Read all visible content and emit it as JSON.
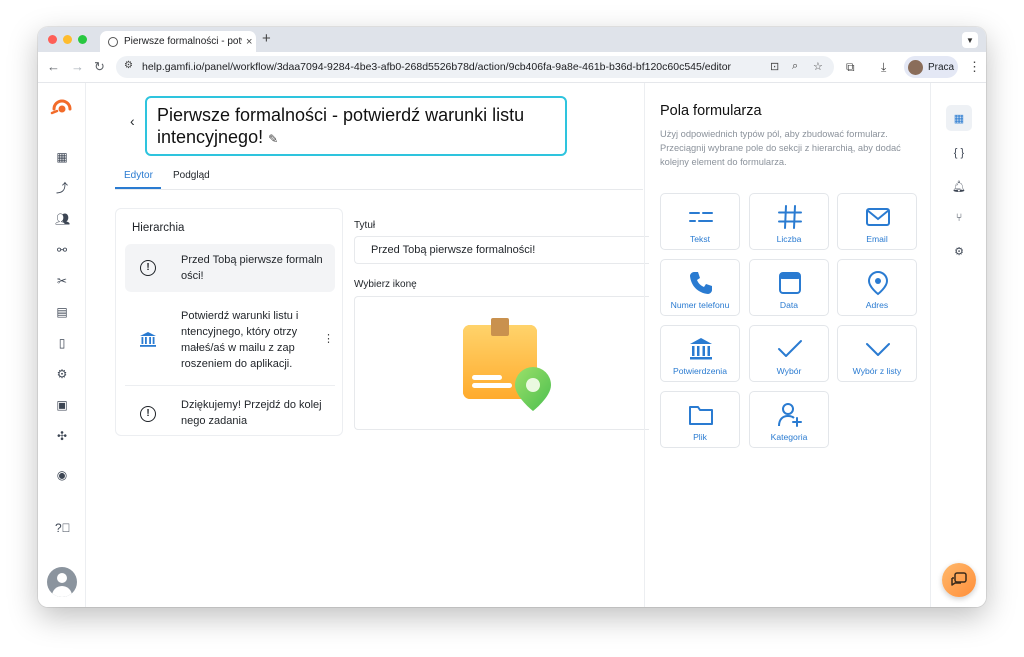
{
  "browser": {
    "tab_title": "Pierwsze formalności - potwi",
    "tab_close": "×",
    "new_tab": "+",
    "url": "help.gamfi.io/panel/workflow/3daa7094-9284-4be3-afb0-268d5526b78d/action/9cb406fa-9a8e-461b-b36d-bf120c60c545/editor",
    "profile_name": "Praca"
  },
  "editor": {
    "title": "Pierwsze formalności - potwierdź warunki listu intencyjnego!",
    "tabs": [
      "Edytor",
      "Podgląd"
    ]
  },
  "hierarchy": {
    "heading": "Hierarchia",
    "items": [
      {
        "text": "Przed Tobą pierwsze formaln ości!",
        "icon": "alert-circle-icon"
      },
      {
        "text": "Potwierdź warunki listu i ntencyjnego, który otrzy małeś/aś w mailu z zap roszeniem do aplikacji.",
        "icon": "bank-icon"
      },
      {
        "text": "Dziękujemy! Przejdź do kolej nego zadania",
        "icon": "alert-circle-icon"
      }
    ]
  },
  "form": {
    "title_label": "Tytuł",
    "title_value": "Przed Tobą pierwsze formalności!",
    "icon_label": "Wybierz ikonę"
  },
  "fields_panel": {
    "heading": "Pola formularza",
    "description": "Użyj odpowiednich typów pól, aby zbudować formularz. Przeciągnij wybrane pole do sekcji z hierarchią, aby dodać kolejny element do formularza.",
    "tiles": [
      {
        "label": "Tekst",
        "icon": "text-icon"
      },
      {
        "label": "Liczba",
        "icon": "hash-icon"
      },
      {
        "label": "Email",
        "icon": "envelope-icon"
      },
      {
        "label": "Numer telefonu",
        "icon": "phone-icon"
      },
      {
        "label": "Data",
        "icon": "calendar-icon"
      },
      {
        "label": "Adres",
        "icon": "map-pin-icon"
      },
      {
        "label": "Potwierdzenia",
        "icon": "bank-icon"
      },
      {
        "label": "Wybór",
        "icon": "check-icon"
      },
      {
        "label": "Wybór z listy",
        "icon": "chevron-down-icon"
      },
      {
        "label": "Plik",
        "icon": "folder-icon"
      },
      {
        "label": "Kategoria",
        "icon": "user-plus-icon"
      }
    ]
  },
  "colors": {
    "accent": "#2a7bd1",
    "title_border": "#2ec4de",
    "chat_button": "#ff9f45"
  }
}
